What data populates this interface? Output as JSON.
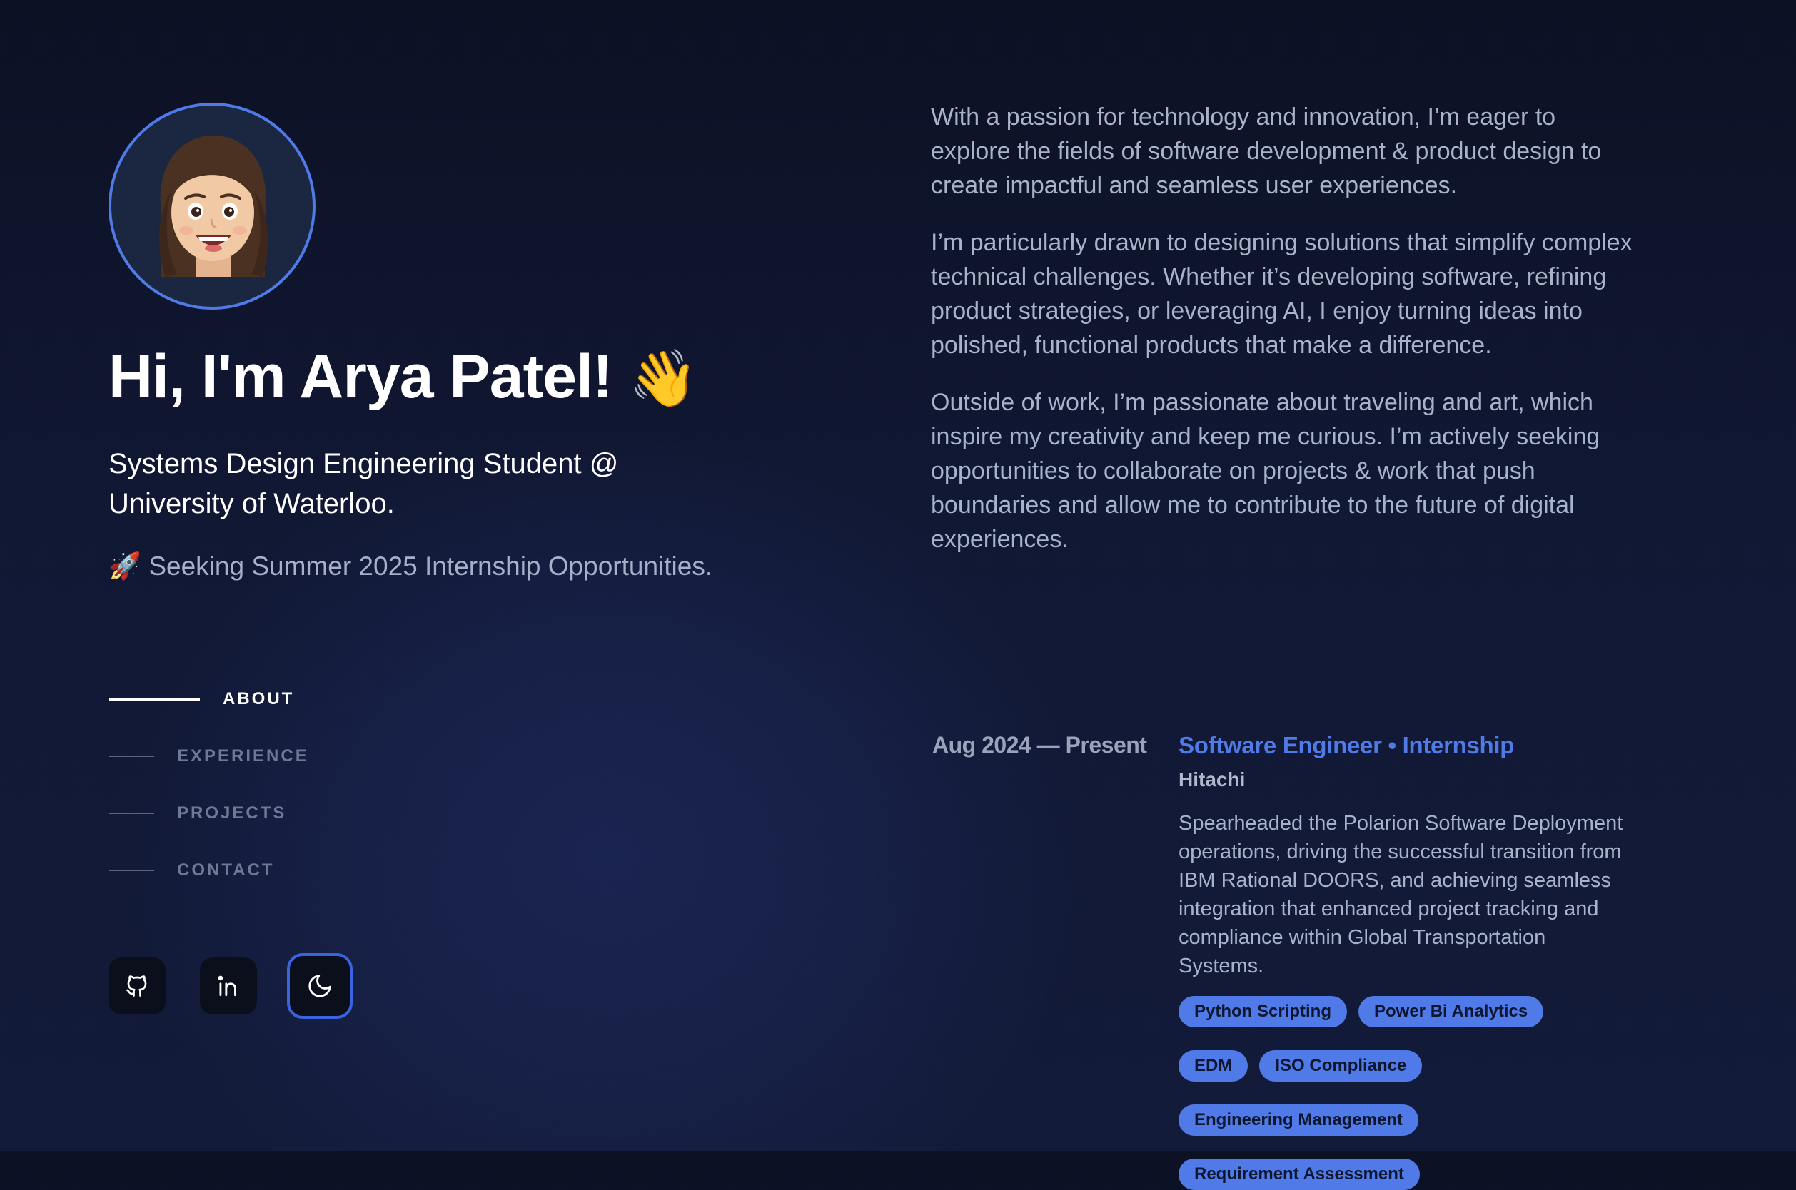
{
  "hero": {
    "title": "Hi, I'm Arya Patel!",
    "wave_emoji": "👋",
    "subtitle": "Systems Design Engineering Student @ University of Waterloo.",
    "seeking": "🚀 Seeking Summer 2025 Internship Opportunities."
  },
  "nav": {
    "items": [
      {
        "label": "ABOUT",
        "active": true
      },
      {
        "label": "EXPERIENCE",
        "active": false
      },
      {
        "label": "PROJECTS",
        "active": false
      },
      {
        "label": "CONTACT",
        "active": false
      }
    ]
  },
  "socials": {
    "icons": [
      "github-icon",
      "linkedin-icon",
      "moon-icon"
    ]
  },
  "about": {
    "paragraphs": [
      "With a passion for technology and innovation, I’m eager to explore the fields of software development & product design to create impactful and seamless user experiences.",
      "I’m particularly drawn to designing solutions that simplify complex technical challenges. Whether it’s developing software, refining product strategies, or leveraging AI, I enjoy turning ideas into polished, functional products that make a difference.",
      "Outside of work, I’m passionate about traveling and art, which inspire my creativity and keep me curious. I’m actively seeking opportunities to collaborate on projects & work that push boundaries and allow me to contribute to the future of digital experiences."
    ]
  },
  "experience": {
    "date": "Aug 2024 — Present",
    "title": "Software Engineer • Internship",
    "company": "Hitachi",
    "description": "Spearheaded the Polarion Software Deployment operations, driving the successful transition from IBM Rational DOORS, and achieving seamless integration that enhanced project tracking and compliance within Global Transportation Systems.",
    "tags": [
      "Python Scripting",
      "Power Bi Analytics",
      "EDM",
      "ISO Compliance",
      "Engineering Management",
      "Requirement Assessment"
    ]
  },
  "colors": {
    "accent": "#4f7ae8",
    "background": "#111834",
    "muted_text": "#a8b2c8"
  }
}
